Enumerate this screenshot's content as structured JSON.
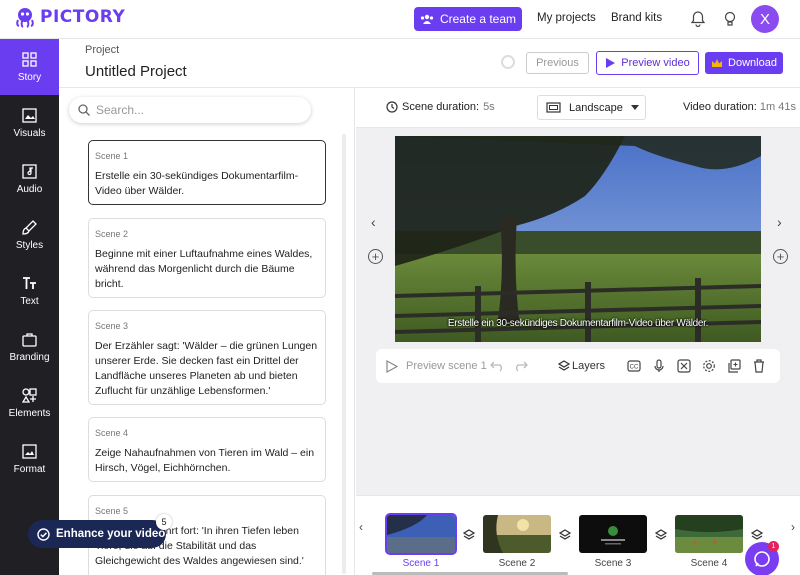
{
  "app": {
    "logo_text": "PICTORY"
  },
  "topbar": {
    "create_team": "Create a team",
    "my_projects": "My projects",
    "brand_kits": "Brand kits",
    "avatar_initial": "X"
  },
  "sidebar": {
    "items": [
      {
        "label": "Story",
        "icon": "grid-icon",
        "active": true
      },
      {
        "label": "Visuals",
        "icon": "image-icon"
      },
      {
        "label": "Audio",
        "icon": "music-note-icon"
      },
      {
        "label": "Styles",
        "icon": "brush-icon"
      },
      {
        "label": "Text",
        "icon": "text-icon"
      },
      {
        "label": "Branding",
        "icon": "briefcase-icon"
      },
      {
        "label": "Elements",
        "icon": "shapes-icon"
      },
      {
        "label": "Format",
        "icon": "image-frame-icon"
      }
    ]
  },
  "project": {
    "label": "Project",
    "title": "Untitled Project",
    "previous": "Previous",
    "preview_video": "Preview video",
    "download": "Download"
  },
  "search": {
    "placeholder": "Search..."
  },
  "scenes": [
    {
      "name": "Scene 1",
      "text": "Erstelle ein 30-sekündiges Dokumentarfilm-Video über Wälder."
    },
    {
      "name": "Scene 2",
      "text": "Beginne mit einer Luftaufnahme eines Waldes, während das Morgenlicht durch die Bäume bricht."
    },
    {
      "name": "Scene 3",
      "text": "Der Erzähler sagt: 'Wälder – die grünen Lungen unserer Erde. Sie decken fast ein Drittel der Landfläche unseres Planeten ab und bieten Zuflucht für unzählige Lebensformen.'"
    },
    {
      "name": "Scene 4",
      "text": "Zeige Nahaufnahmen von Tieren im Wald – ein Hirsch, Vögel, Eichhörnchen."
    },
    {
      "name": "Scene 5",
      "text": "Der Erzähler fährt fort: 'In ihren Tiefen leben Tiere, die auf die Stabilität und das Gleichgewicht des Waldes angewiesen sind.'"
    }
  ],
  "enhance": {
    "label": "Enhance your video",
    "badge": "5"
  },
  "editor": {
    "scene_duration_label": "Scene duration:",
    "scene_duration_value": "5s",
    "orientation": "Landscape",
    "video_duration_label": "Video duration:",
    "video_duration_value": "1m 41s",
    "caption": "Erstelle ein 30-sekündiges Dokumentarfilm-Video über Wälder.",
    "preview_scene": "Preview scene 1",
    "layers": "Layers"
  },
  "timeline": {
    "labels": [
      "Scene 1",
      "Scene 2",
      "Scene 3",
      "Scene 4"
    ]
  },
  "chat": {
    "badge": "1"
  },
  "colors": {
    "accent": "#6b3df0",
    "sidebar_bg": "#202024",
    "enhance_bg": "#1b2754"
  }
}
